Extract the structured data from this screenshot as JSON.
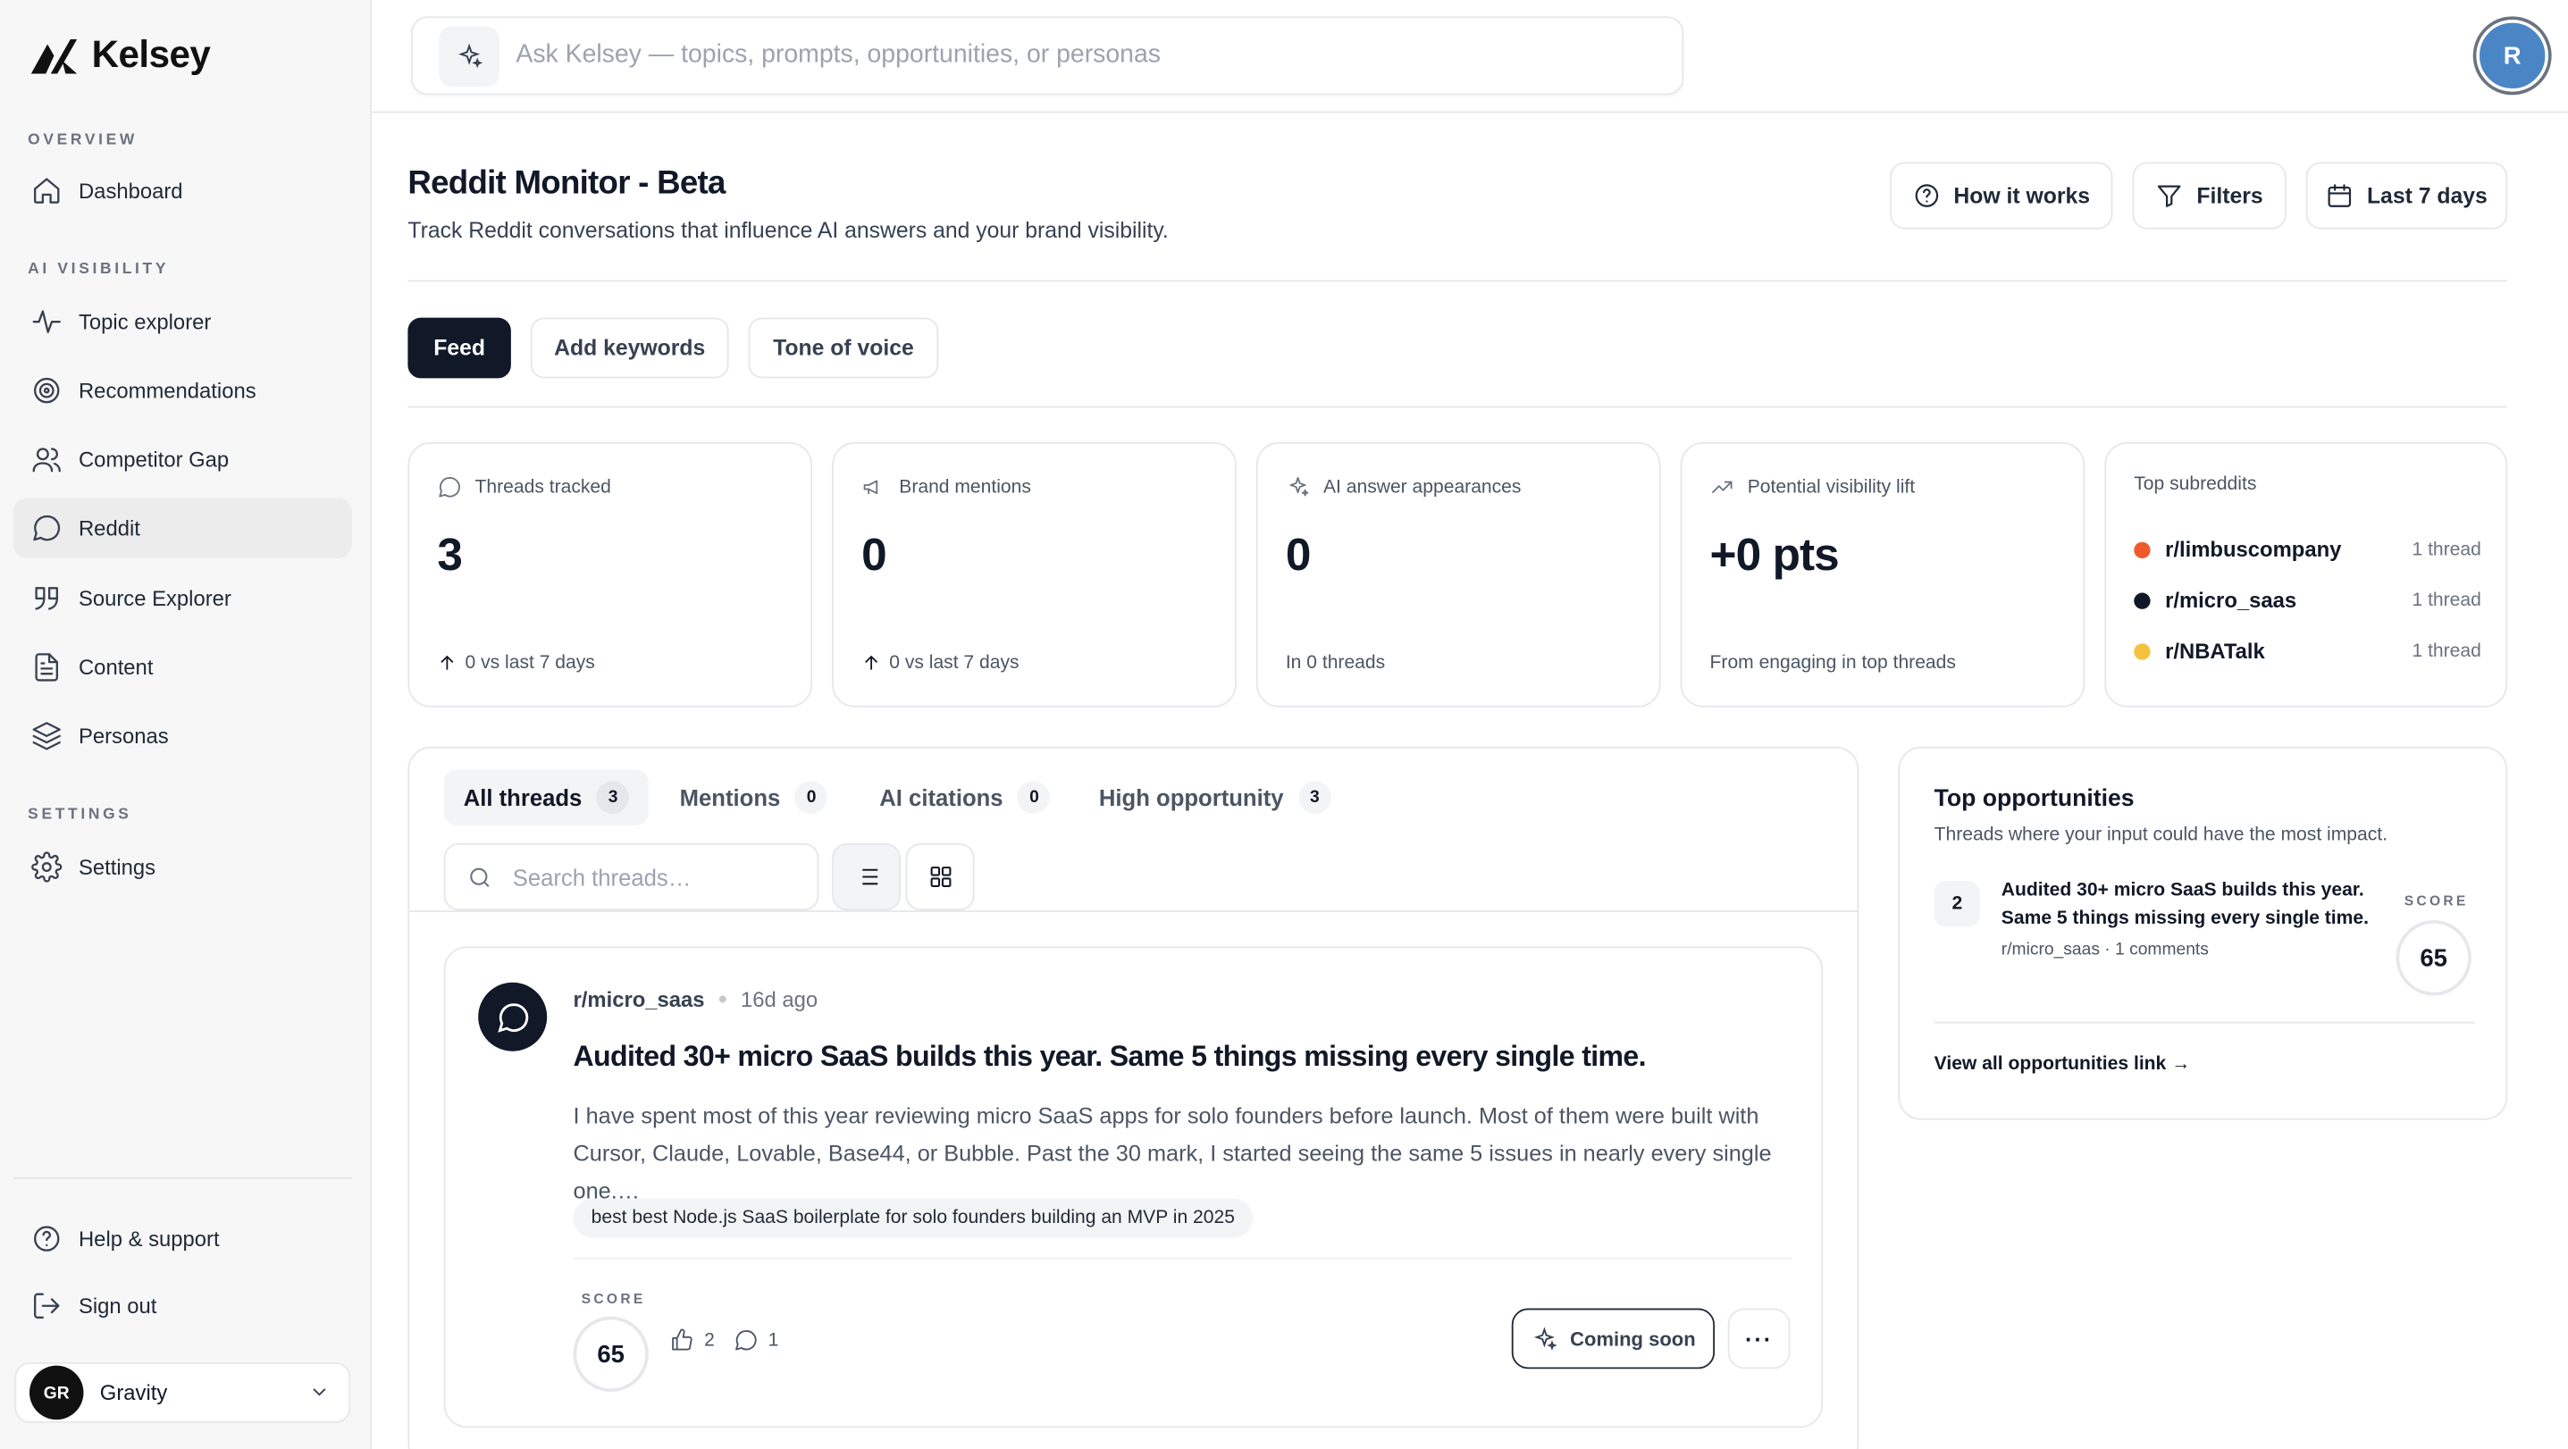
{
  "app": {
    "name": "Kelsey"
  },
  "sidebar": {
    "sections": {
      "overview": "OVERVIEW",
      "ai_visibility": "AI VISIBILITY",
      "settings": "SETTINGS"
    },
    "items": [
      {
        "label": "Dashboard",
        "icon": "home-icon"
      },
      {
        "label": "Topic explorer",
        "icon": "activity-icon"
      },
      {
        "label": "Recommendations",
        "icon": "target-icon"
      },
      {
        "label": "Competitor Gap",
        "icon": "users-icon"
      },
      {
        "label": "Reddit",
        "icon": "chat-icon",
        "active": true
      },
      {
        "label": "Source Explorer",
        "icon": "quote-icon"
      },
      {
        "label": "Content",
        "icon": "document-icon"
      },
      {
        "label": "Personas",
        "icon": "layers-icon"
      },
      {
        "label": "Settings",
        "icon": "gear-icon"
      }
    ],
    "footer": {
      "help": "Help & support",
      "signout": "Sign out"
    },
    "workspace": {
      "initials": "GR",
      "name": "Gravity"
    }
  },
  "topbar": {
    "ask_placeholder": "Ask Kelsey — topics, prompts, opportunities, or personas",
    "user_initial": "R"
  },
  "header": {
    "title": "Reddit Monitor - Beta",
    "subtitle": "Track Reddit conversations that influence AI answers and your brand visibility.",
    "buttons": {
      "how_it_works": "How it works",
      "filters": "Filters",
      "date_range": "Last 7 days"
    }
  },
  "tabs": {
    "feed": "Feed",
    "add_keywords": "Add keywords",
    "tone": "Tone of voice"
  },
  "stats": {
    "threads": {
      "label": "Threads tracked",
      "value": "3",
      "foot": "0 vs last 7 days"
    },
    "mentions": {
      "label": "Brand mentions",
      "value": "0",
      "foot": "0 vs last 7 days"
    },
    "ai": {
      "label": "AI answer appearances",
      "value": "0",
      "foot": "In 0 threads"
    },
    "lift": {
      "label": "Potential visibility lift",
      "value": "+0 pts",
      "foot": "From engaging in top threads"
    },
    "subreddits": {
      "label": "Top subreddits",
      "rows": [
        {
          "name": "r/limbuscompany",
          "count": "1 thread",
          "color": "#ef5a2a"
        },
        {
          "name": "r/micro_saas",
          "count": "1 thread",
          "color": "#111827"
        },
        {
          "name": "r/NBATalk",
          "count": "1 thread",
          "color": "#f4c23d"
        }
      ]
    }
  },
  "threads": {
    "tabs": [
      {
        "label": "All threads",
        "count": "3"
      },
      {
        "label": "Mentions",
        "count": "0"
      },
      {
        "label": "AI citations",
        "count": "0"
      },
      {
        "label": "High opportunity",
        "count": "3"
      }
    ],
    "search_placeholder": "Search threads…",
    "card": {
      "subreddit": "r/micro_saas",
      "time": "16d ago",
      "title": "Audited 30+ micro SaaS builds this year. Same 5 things missing every single time.",
      "body": "I have spent most of this year reviewing micro SaaS apps for solo founders before launch. Most of them were built with Cursor, Claude, Lovable, Base44, or Bubble. Past the 30 mark, I started seeing the same 5 issues in nearly every single one.…",
      "tag": "best best Node.js SaaS boilerplate for solo founders building an MVP in 2025",
      "score_label": "SCORE",
      "score": "65",
      "upvotes": "2",
      "comments": "1",
      "action": "Coming soon",
      "more": "···"
    }
  },
  "opportunities": {
    "title": "Top opportunities",
    "subtitle": "Threads where your input could have the most impact.",
    "item": {
      "rank": "2",
      "title": "Audited 30+ micro SaaS builds this year. Same 5 things missing every single time.",
      "meta": "r/micro_saas · 1 comments",
      "score_label": "SCORE",
      "score": "65"
    },
    "link": "View all opportunities link →"
  }
}
